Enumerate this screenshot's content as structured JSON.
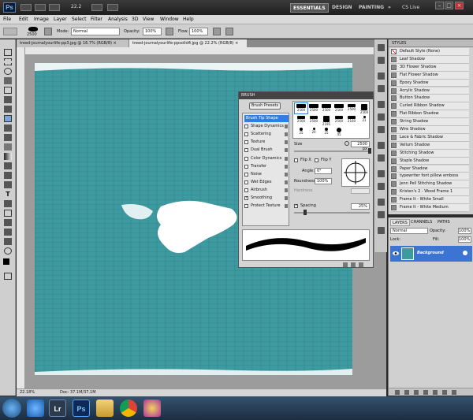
{
  "app": {
    "logo": "Ps",
    "zoom": "22.2",
    "workspaces": [
      "ESSENTIALS",
      "DESIGN",
      "PAINTING"
    ],
    "more": "»",
    "cs_live": "CS Live"
  },
  "menu": [
    "File",
    "Edit",
    "Image",
    "Layer",
    "Select",
    "Filter",
    "Analysis",
    "3D",
    "View",
    "Window",
    "Help"
  ],
  "options": {
    "brush_size": "2500",
    "mode_label": "Mode:",
    "mode_value": "Normal",
    "opacity_label": "Opacity:",
    "opacity_value": "100%",
    "flow_label": "Flow:",
    "flow_value": "100%"
  },
  "tabs": [
    "treed-journalyourlife-pp3.jpg @ 16.7% (RGB/8) ×",
    "treed-journalyourlife-ppsolid4.jpg @ 22.2% (RGB/8) ×"
  ],
  "status": {
    "zoom": "22.18%",
    "doc": "Doc: 37.1M/37.1M"
  },
  "brush_panel": {
    "title": "BRUSH",
    "presets_button": "Brush Presets",
    "list": [
      "Brush Tip Shape",
      "Shape Dynamics",
      "Scattering",
      "Texture",
      "Dual Brush",
      "Color Dynamics",
      "Transfer",
      "Noise",
      "Wet Edges",
      "Airbrush",
      "Smoothing",
      "Protect Texture"
    ],
    "checked": [
      10
    ],
    "tips": [
      "2500",
      "2500",
      "2500",
      "2500",
      "2500",
      "2500",
      "2500",
      "2500",
      "2195",
      "2500",
      "2160",
      "21",
      "25",
      "20",
      "25",
      "45"
    ],
    "size_label": "Size",
    "size_value": "2500 px",
    "flipx": "Flip X",
    "flipy": "Flip Y",
    "angle_label": "Angle:",
    "angle_value": "0°",
    "round_label": "Roundness:",
    "round_value": "100%",
    "hardness_label": "Hardness",
    "spacing_label": "Spacing",
    "spacing_value": "25%"
  },
  "styles_panel": {
    "title": "STYLES",
    "items": [
      "Default Style (None)",
      "Leaf Shadow",
      "3D Flower Shadow",
      "Flat Flower Shadow",
      "Epoxy Shadow",
      "Acrylic Shadow",
      "Button Shadow",
      "Curled Ribbon Shadow",
      "Flat Ribbon Shadow",
      "String Shadow",
      "Wire Shadow",
      "Lace & Fabric Shadow",
      "Vellum Shadow",
      "Stitching Shadow",
      "Staple Shadow",
      "Paper Shadow",
      "typewriter font pillow emboss",
      "Jenn Pell Stitching Shadow",
      "Kristen's 2 - Wood Frame 1",
      "Frame It - White Small",
      "Frame It - White Medium"
    ]
  },
  "layers_panel": {
    "tabs": [
      "LAYERS",
      "CHANNELS",
      "PATHS"
    ],
    "mode": "Normal",
    "opacity_label": "Opacity:",
    "opacity_value": "100%",
    "lock_label": "Lock:",
    "fill_label": "Fill:",
    "fill_value": "100%",
    "layer_name": "Background"
  },
  "taskbar": {
    "lr": "Lr",
    "ps": "Ps"
  },
  "colors": {
    "canvas": "#3e9aa1",
    "selection": "#3b74d2"
  }
}
